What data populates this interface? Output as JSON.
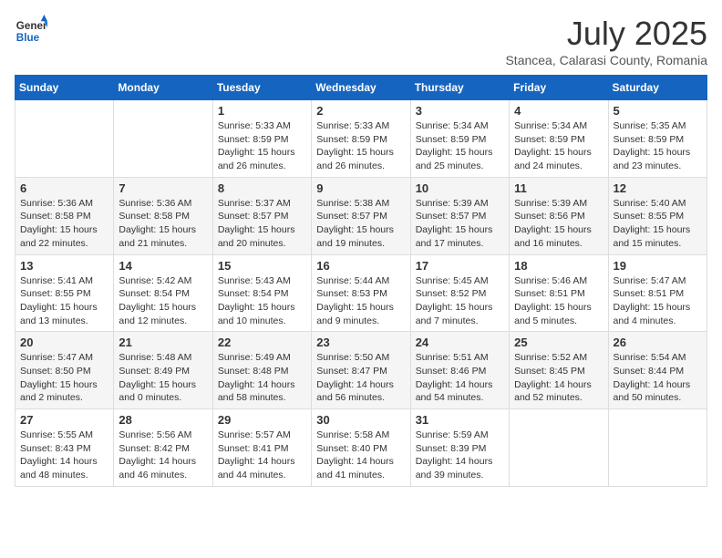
{
  "header": {
    "logo": {
      "general": "General",
      "blue": "Blue"
    },
    "title": "July 2025",
    "subtitle": "Stancea, Calarasi County, Romania"
  },
  "calendar": {
    "days_of_week": [
      "Sunday",
      "Monday",
      "Tuesday",
      "Wednesday",
      "Thursday",
      "Friday",
      "Saturday"
    ],
    "weeks": [
      [
        {
          "day": "",
          "info": ""
        },
        {
          "day": "",
          "info": ""
        },
        {
          "day": "1",
          "info": "Sunrise: 5:33 AM\nSunset: 8:59 PM\nDaylight: 15 hours\nand 26 minutes."
        },
        {
          "day": "2",
          "info": "Sunrise: 5:33 AM\nSunset: 8:59 PM\nDaylight: 15 hours\nand 26 minutes."
        },
        {
          "day": "3",
          "info": "Sunrise: 5:34 AM\nSunset: 8:59 PM\nDaylight: 15 hours\nand 25 minutes."
        },
        {
          "day": "4",
          "info": "Sunrise: 5:34 AM\nSunset: 8:59 PM\nDaylight: 15 hours\nand 24 minutes."
        },
        {
          "day": "5",
          "info": "Sunrise: 5:35 AM\nSunset: 8:59 PM\nDaylight: 15 hours\nand 23 minutes."
        }
      ],
      [
        {
          "day": "6",
          "info": "Sunrise: 5:36 AM\nSunset: 8:58 PM\nDaylight: 15 hours\nand 22 minutes."
        },
        {
          "day": "7",
          "info": "Sunrise: 5:36 AM\nSunset: 8:58 PM\nDaylight: 15 hours\nand 21 minutes."
        },
        {
          "day": "8",
          "info": "Sunrise: 5:37 AM\nSunset: 8:57 PM\nDaylight: 15 hours\nand 20 minutes."
        },
        {
          "day": "9",
          "info": "Sunrise: 5:38 AM\nSunset: 8:57 PM\nDaylight: 15 hours\nand 19 minutes."
        },
        {
          "day": "10",
          "info": "Sunrise: 5:39 AM\nSunset: 8:57 PM\nDaylight: 15 hours\nand 17 minutes."
        },
        {
          "day": "11",
          "info": "Sunrise: 5:39 AM\nSunset: 8:56 PM\nDaylight: 15 hours\nand 16 minutes."
        },
        {
          "day": "12",
          "info": "Sunrise: 5:40 AM\nSunset: 8:55 PM\nDaylight: 15 hours\nand 15 minutes."
        }
      ],
      [
        {
          "day": "13",
          "info": "Sunrise: 5:41 AM\nSunset: 8:55 PM\nDaylight: 15 hours\nand 13 minutes."
        },
        {
          "day": "14",
          "info": "Sunrise: 5:42 AM\nSunset: 8:54 PM\nDaylight: 15 hours\nand 12 minutes."
        },
        {
          "day": "15",
          "info": "Sunrise: 5:43 AM\nSunset: 8:54 PM\nDaylight: 15 hours\nand 10 minutes."
        },
        {
          "day": "16",
          "info": "Sunrise: 5:44 AM\nSunset: 8:53 PM\nDaylight: 15 hours\nand 9 minutes."
        },
        {
          "day": "17",
          "info": "Sunrise: 5:45 AM\nSunset: 8:52 PM\nDaylight: 15 hours\nand 7 minutes."
        },
        {
          "day": "18",
          "info": "Sunrise: 5:46 AM\nSunset: 8:51 PM\nDaylight: 15 hours\nand 5 minutes."
        },
        {
          "day": "19",
          "info": "Sunrise: 5:47 AM\nSunset: 8:51 PM\nDaylight: 15 hours\nand 4 minutes."
        }
      ],
      [
        {
          "day": "20",
          "info": "Sunrise: 5:47 AM\nSunset: 8:50 PM\nDaylight: 15 hours\nand 2 minutes."
        },
        {
          "day": "21",
          "info": "Sunrise: 5:48 AM\nSunset: 8:49 PM\nDaylight: 15 hours\nand 0 minutes."
        },
        {
          "day": "22",
          "info": "Sunrise: 5:49 AM\nSunset: 8:48 PM\nDaylight: 14 hours\nand 58 minutes."
        },
        {
          "day": "23",
          "info": "Sunrise: 5:50 AM\nSunset: 8:47 PM\nDaylight: 14 hours\nand 56 minutes."
        },
        {
          "day": "24",
          "info": "Sunrise: 5:51 AM\nSunset: 8:46 PM\nDaylight: 14 hours\nand 54 minutes."
        },
        {
          "day": "25",
          "info": "Sunrise: 5:52 AM\nSunset: 8:45 PM\nDaylight: 14 hours\nand 52 minutes."
        },
        {
          "day": "26",
          "info": "Sunrise: 5:54 AM\nSunset: 8:44 PM\nDaylight: 14 hours\nand 50 minutes."
        }
      ],
      [
        {
          "day": "27",
          "info": "Sunrise: 5:55 AM\nSunset: 8:43 PM\nDaylight: 14 hours\nand 48 minutes."
        },
        {
          "day": "28",
          "info": "Sunrise: 5:56 AM\nSunset: 8:42 PM\nDaylight: 14 hours\nand 46 minutes."
        },
        {
          "day": "29",
          "info": "Sunrise: 5:57 AM\nSunset: 8:41 PM\nDaylight: 14 hours\nand 44 minutes."
        },
        {
          "day": "30",
          "info": "Sunrise: 5:58 AM\nSunset: 8:40 PM\nDaylight: 14 hours\nand 41 minutes."
        },
        {
          "day": "31",
          "info": "Sunrise: 5:59 AM\nSunset: 8:39 PM\nDaylight: 14 hours\nand 39 minutes."
        },
        {
          "day": "",
          "info": ""
        },
        {
          "day": "",
          "info": ""
        }
      ]
    ]
  }
}
